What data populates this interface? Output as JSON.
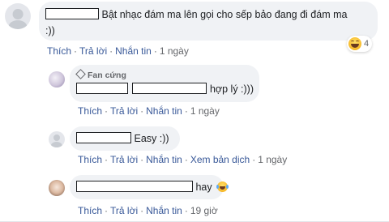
{
  "comments": [
    {
      "text": "Bật nhạc đám ma lên gọi cho sếp bảo đang đi đám ma",
      "text_cont": ":))",
      "actions": {
        "like": "Thích",
        "reply": "Trả lời",
        "message": "Nhắn tin",
        "time": "1 ngày"
      },
      "reaction": {
        "icon": "haha-emoji-icon",
        "count": "4"
      }
    }
  ],
  "replies": [
    {
      "badge": "Fan cứng",
      "text": "hợp lý :)))",
      "actions": {
        "like": "Thích",
        "reply": "Trả lời",
        "message": "Nhắn tin",
        "time": "1 ngày"
      }
    },
    {
      "text": "Easy :))",
      "actions": {
        "like": "Thích",
        "reply": "Trả lời",
        "message": "Nhắn tin",
        "translate": "Xem bản dịch",
        "time": "1 ngày"
      }
    },
    {
      "text": "hay",
      "emoji": "laughing-tears-emoji-icon",
      "actions": {
        "like": "Thích",
        "reply": "Trả lời",
        "message": "Nhắn tin",
        "time": "19 giờ"
      }
    }
  ],
  "separator": "·",
  "colors": {
    "bubble": "#f0f2f5",
    "link": "#385898",
    "meta": "#65676b",
    "text": "#1c1e21"
  }
}
